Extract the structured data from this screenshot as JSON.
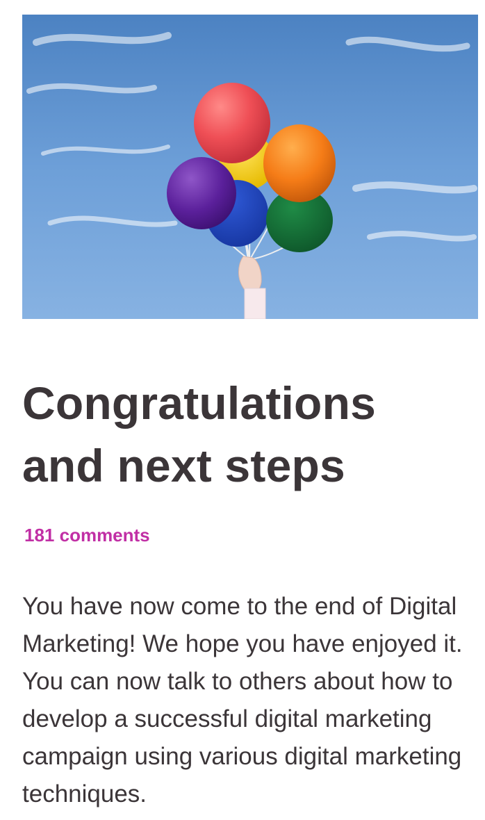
{
  "hero": {
    "image_name": "balloons-against-blue-sky"
  },
  "article": {
    "title": "Congratulations and next steps",
    "comments_label": "181 comments",
    "body": "You have now come to the end of Digital Marketing! We hope you have enjoyed it. You can now talk to others about how to develop a successful digital marketing campaign using various digital marketing techniques."
  },
  "colors": {
    "title_text": "#3b3538",
    "link_accent": "#c12fa5",
    "body_text": "#3b3538",
    "sky": "#6f9fd7"
  }
}
